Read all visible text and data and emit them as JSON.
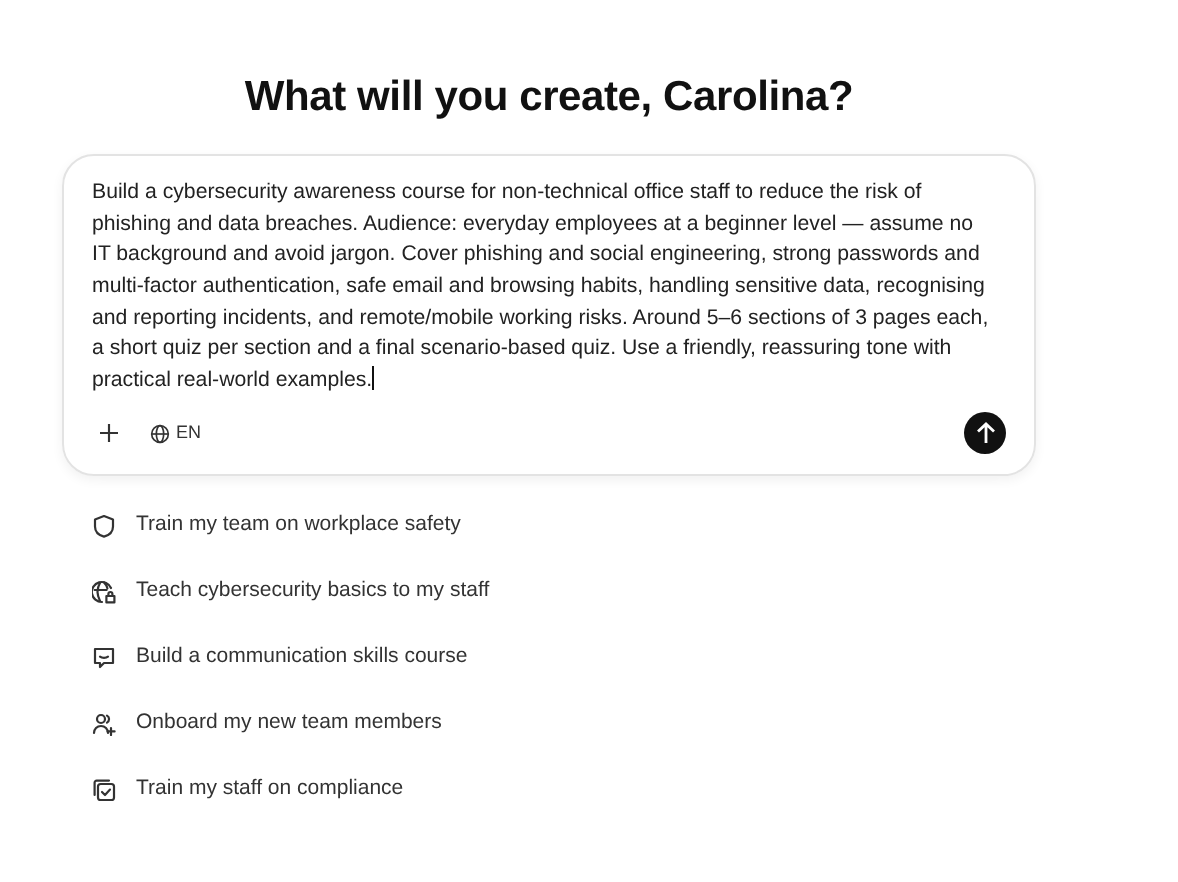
{
  "heading": "What will you create, Carolina?",
  "prompt": {
    "value": "Build a cybersecurity awareness course for non-technical office staff to reduce the risk of phishing and data breaches. Audience: everyday employees at a beginner level — assume no IT background and avoid jargon. Cover phishing and social engineering, strong passwords and multi-factor authentication, safe email and browsing habits, handling sensitive data, recognising and reporting incidents, and remote/mobile working risks. Around 5–6 sections of 3 pages each, a short quiz per section and a final scenario-based quiz. Use a friendly, reassuring tone with practical real-world examples.",
    "language": "EN"
  },
  "suggestions": [
    {
      "kind": "shield",
      "label": "Train my team on workplace safety"
    },
    {
      "kind": "globe-lock",
      "label": "Teach cybersecurity basics to my staff"
    },
    {
      "kind": "chat",
      "label": "Build a communication skills course"
    },
    {
      "kind": "user-plus",
      "label": "Onboard my new team members"
    },
    {
      "kind": "copy-check",
      "label": "Train my staff on compliance"
    }
  ]
}
